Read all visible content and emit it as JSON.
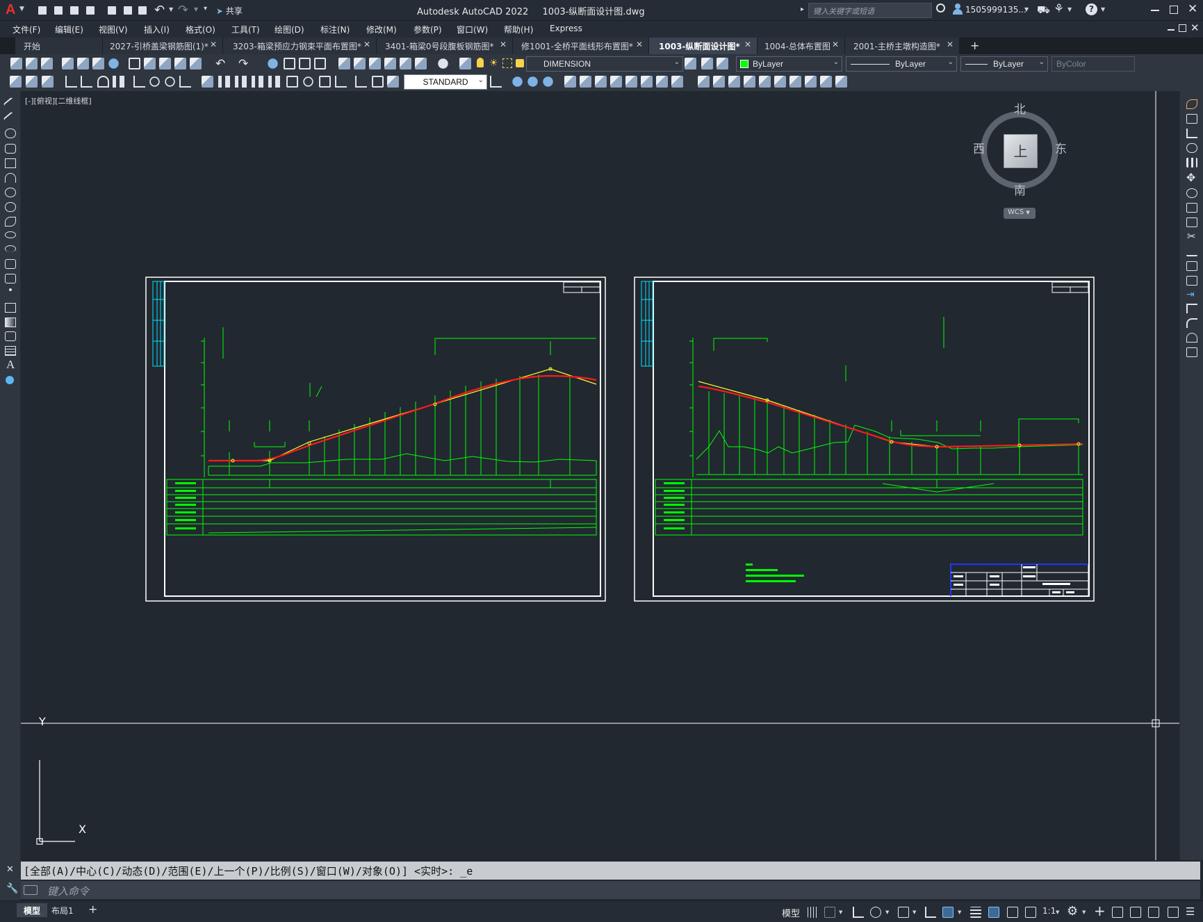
{
  "window": {
    "app_title": "Autodesk AutoCAD 2022",
    "file_title": "1003-纵断面设计图.dwg",
    "share_label": "共享",
    "search_placeholder": "键入关键字或短语",
    "user_name": "1505999135...",
    "logo_letter": "A"
  },
  "menu": [
    "文件(F)",
    "编辑(E)",
    "视图(V)",
    "插入(I)",
    "格式(O)",
    "工具(T)",
    "绘图(D)",
    "标注(N)",
    "修改(M)",
    "参数(P)",
    "窗口(W)",
    "帮助(H)",
    "Express"
  ],
  "tabs": [
    {
      "label": "开始",
      "closable": false,
      "active": false
    },
    {
      "label": "2027-引桥盖梁钢筋图(1)*",
      "closable": true,
      "active": false
    },
    {
      "label": "3203-箱梁预应力钢束平面布置图*",
      "closable": true,
      "active": false
    },
    {
      "label": "3401-箱梁0号段腹板钢筋图*",
      "closable": true,
      "active": false
    },
    {
      "label": "修1001-全桥平面线形布置图*",
      "closable": true,
      "active": false
    },
    {
      "label": "1003-纵断面设计图*",
      "closable": true,
      "active": true
    },
    {
      "label": "1004-总体布置图",
      "closable": true,
      "active": false
    },
    {
      "label": "2001-主桥主墩构造图*",
      "closable": true,
      "active": false
    }
  ],
  "tab_add_label": "+",
  "tab_close_glyph": "✕",
  "toolbar": {
    "layer_value": "DIMENSION",
    "color_value": "ByLayer",
    "linetype_value": "ByLayer",
    "lineweight_value": "ByLayer",
    "plotstyle_value": "ByColor",
    "textstyle_value": "STANDARD"
  },
  "viewport": {
    "view_label": "[-][俯视][二维线框]",
    "compass": {
      "north": "北",
      "south": "南",
      "east": "东",
      "west": "西",
      "top_face": "上"
    },
    "wcs_label": "WCS",
    "ucs_x": "X",
    "ucs_y": "Y"
  },
  "command": {
    "history": "[全部(A)/中心(C)/动态(D)/范围(E)/上一个(P)/比例(S)/窗口(W)/对象(O)] <实时>: _e",
    "placeholder": "键入命令"
  },
  "status": {
    "layout_tabs": [
      {
        "label": "模型",
        "active": true
      },
      {
        "label": "布局1",
        "active": false
      }
    ],
    "add_layout": "+",
    "model_label": "模型",
    "scale_label": "1:1"
  },
  "colors": {
    "drawing_bg": "#212830",
    "cad_green": "#00ff00",
    "cad_red": "#ff1a1a",
    "cad_yellow": "#ffff33",
    "cad_cyan": "#00e5ff",
    "cad_white": "#ffffff",
    "cad_blue": "#2233ff"
  },
  "icons": {
    "logo": "autocad-logo-icon",
    "share": "share-arrow-icon",
    "search": "search-icon",
    "user": "user-icon",
    "cart": "cart-icon",
    "help": "help-icon"
  }
}
